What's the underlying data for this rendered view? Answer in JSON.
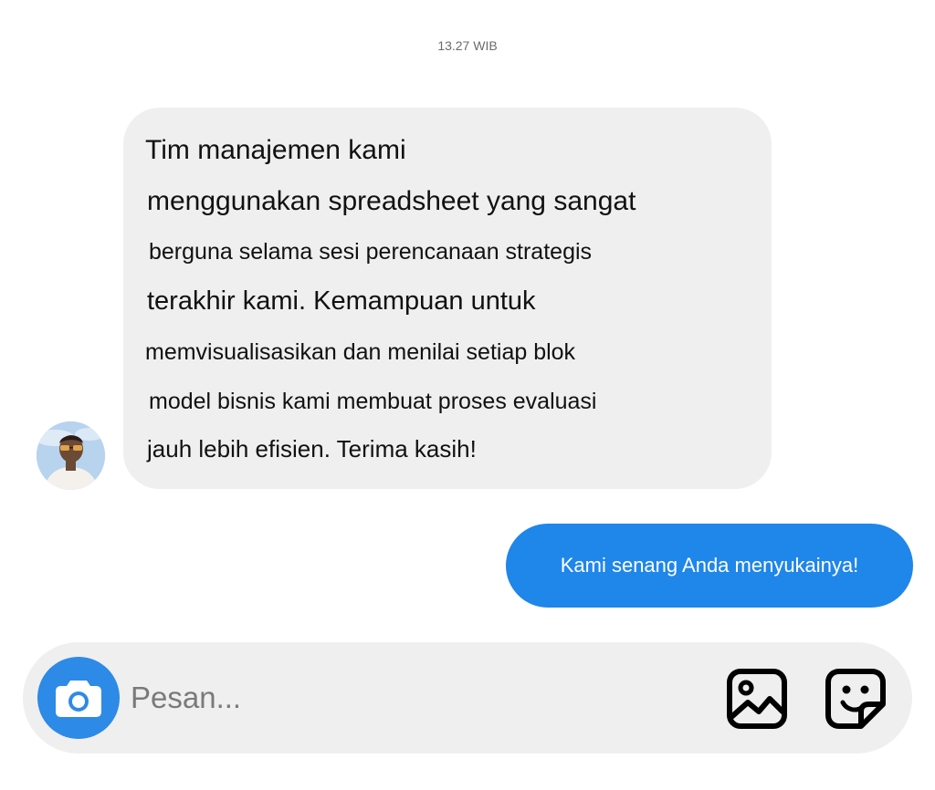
{
  "chat": {
    "timestamp": "13.27 WIB",
    "incoming": {
      "lines": [
        "Tim manajemen kami",
        "menggunakan spreadsheet yang sangat",
        "berguna selama sesi perencanaan strategis",
        "terakhir kami. Kemampuan untuk",
        "memvisualisasikan dan menilai setiap blok",
        "model bisnis kami membuat proses evaluasi",
        "jauh lebih efisien. Terima kasih!"
      ]
    },
    "outgoing": {
      "text": "Kami senang Anda menyukainya!"
    }
  },
  "composer": {
    "placeholder": "Pesan...",
    "value": "",
    "camera_icon": "camera-icon",
    "gallery_icon": "image-icon",
    "sticker_icon": "sticker-icon"
  },
  "colors": {
    "incoming_bubble": "#efefef",
    "outgoing_bubble": "#1f86ea",
    "accent": "#2d8ae6"
  }
}
